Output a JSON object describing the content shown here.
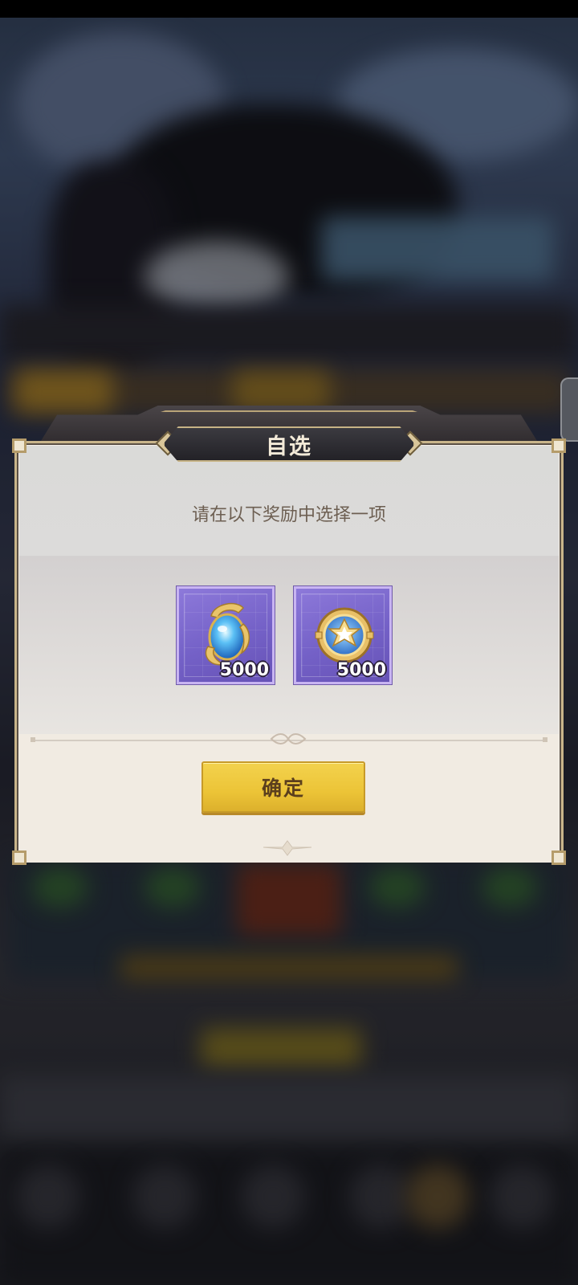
{
  "dialog": {
    "title": "自选",
    "prompt": "请在以下奖励中选择一项",
    "rewards": [
      {
        "icon": "blue-gem-egg-icon",
        "count": "5000"
      },
      {
        "icon": "star-medal-coin-icon",
        "count": "5000"
      }
    ],
    "confirm_label": "确定"
  },
  "colors": {
    "accent_button": "#ecc437",
    "reward_frame": "#7461c7",
    "dialog_bg": "#f4efe7"
  }
}
